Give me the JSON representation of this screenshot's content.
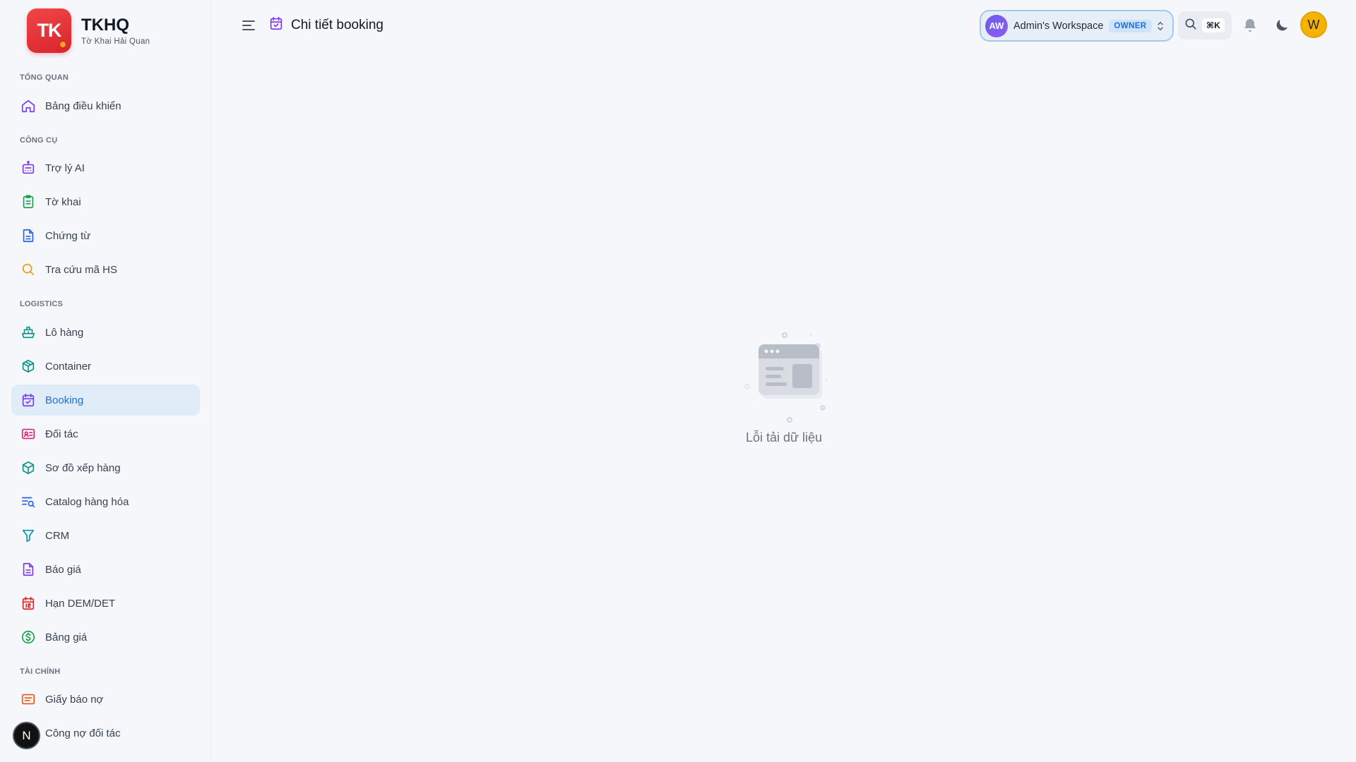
{
  "brand": {
    "logo_text": "TK",
    "name": "TKHQ",
    "subtitle": "Tờ Khai Hải Quan"
  },
  "sidebar": {
    "sections": {
      "overview": "TỔNG QUAN",
      "tools": "CÔNG CỤ",
      "logistics": "LOGISTICS",
      "finance": "TÀI CHÍNH"
    },
    "items": {
      "dashboard": "Bảng điều khiển",
      "ai": "Trợ lý AI",
      "declaration": "Tờ khai",
      "documents": "Chứng từ",
      "hs_lookup": "Tra cứu mã HS",
      "shipments": "Lô hàng",
      "container": "Container",
      "booking": "Booking",
      "partners": "Đối tác",
      "stowage": "Sơ đồ xếp hàng",
      "catalog": "Catalog hàng hóa",
      "crm": "CRM",
      "quotes": "Báo giá",
      "demdet": "Hạn DEM/DET",
      "price_list": "Bảng giá",
      "debit_note": "Giấy báo nợ",
      "partner_debt": "Công nợ đối tác"
    },
    "active": "booking",
    "badge": "N"
  },
  "header": {
    "title": "Chi tiết booking",
    "workspace": {
      "initials": "AW",
      "name": "Admin's Workspace",
      "role": "OWNER"
    },
    "search_shortcut": "⌘K",
    "user_initial": "W"
  },
  "main": {
    "empty_message": "Lỗi tải dữ liệu"
  },
  "colors": {
    "brand_red": "#d8262b",
    "accent_blue": "#1d6fd1",
    "active_bg": "#e0ecf7",
    "user_avatar": "#f5b300"
  },
  "icons": {
    "dashboard": "home-icon",
    "ai": "robot-icon",
    "declaration": "clipboard-icon",
    "documents": "file-text-icon",
    "hs_lookup": "search-icon",
    "shipments": "ship-icon",
    "container": "box-icon",
    "booking": "calendar-check-icon",
    "partners": "id-card-icon",
    "stowage": "cube-icon",
    "catalog": "list-search-icon",
    "crm": "filter-icon",
    "quotes": "file-text-icon",
    "demdet": "calendar-12-icon",
    "price_list": "dollar-circle-icon",
    "debit_note": "message-lines-icon",
    "partner_debt": "wallet-icon"
  }
}
